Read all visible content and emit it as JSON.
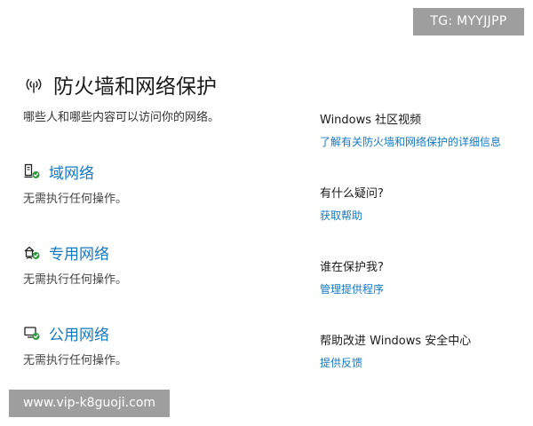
{
  "watermark": {
    "top": "TG: MYYJJPP",
    "bottom": "www.vip-k8guoji.com"
  },
  "header": {
    "title": "防火墙和网络保护",
    "subtitle": "哪些人和哪些内容可以访问你的网络。"
  },
  "networks": [
    {
      "label": "域网络",
      "status": "无需执行任何操作。",
      "icon": "domain-network-icon"
    },
    {
      "label": "专用网络",
      "status": "无需执行任何操作。",
      "icon": "private-network-icon"
    },
    {
      "label": "公用网络",
      "status": "无需执行任何操作。",
      "icon": "public-network-icon"
    }
  ],
  "sidebar": [
    {
      "title": "Windows 社区视频",
      "link": "了解有关防火墙和网络保护的详细信息"
    },
    {
      "title": "有什么疑问?",
      "link": "获取帮助"
    },
    {
      "title": "谁在保护我?",
      "link": "管理提供程序"
    },
    {
      "title": "帮助改进 Windows 安全中心",
      "link": "提供反馈"
    }
  ],
  "colors": {
    "link": "#1479c3",
    "check": "#2e9a3e",
    "watermark_bg": "#9e9e9e"
  }
}
